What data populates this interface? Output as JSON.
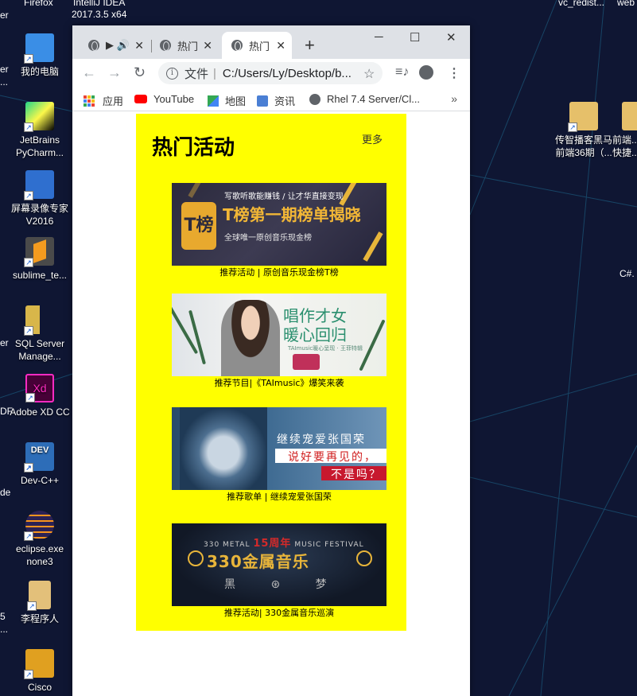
{
  "desktop": {
    "top_labels": [
      "Firefox",
      "IntelliJ IDEA",
      "2017.3.5 x64",
      "vc_redist...",
      "web"
    ],
    "icons_left": [
      {
        "label": "我的电脑",
        "icon": "computer-icon",
        "color": "#3a8ee6"
      },
      {
        "label": "JetBrains PyCharm...",
        "icon": "pycharm-icon",
        "color": "#21d789"
      },
      {
        "label": "屏幕录像专家 V2016",
        "icon": "screen-recorder-icon",
        "color": "#2f6fcf"
      },
      {
        "label": "sublime_te...",
        "icon": "sublime-icon",
        "color": "#f49b1f"
      },
      {
        "label": "SQL Server Manage...",
        "icon": "sql-server-icon",
        "color": "#d8b64a"
      },
      {
        "label": "Adobe XD CC",
        "icon": "adobe-xd-icon",
        "color": "#ff2bc2"
      },
      {
        "label": "Dev-C++",
        "icon": "devcpp-icon",
        "color": "#2d6db8"
      },
      {
        "label": "eclipse.exe none3",
        "icon": "eclipse-icon",
        "color": "#2c2255"
      },
      {
        "label": "李程序人",
        "icon": "document-icon",
        "color": "#e3c07a"
      },
      {
        "label": "Cisco",
        "icon": "cisco-icon",
        "color": "#e0a020"
      }
    ],
    "icons_right": [
      {
        "label": "传智播客黑马 前端36期（...",
        "icon": "folder-icon",
        "color": "#e6c06a"
      },
      {
        "label": "前端... 快捷...",
        "icon": "folder-icon",
        "color": "#e6c06a"
      }
    ],
    "edge_labels": [
      "er",
      "...",
      "er",
      "DF",
      "de",
      "5",
      "...",
      "C#.",
      "P"
    ]
  },
  "browser": {
    "tabs": [
      {
        "label": "▶ 🔊",
        "active": false
      },
      {
        "label": "热门",
        "active": false
      },
      {
        "label": "热门",
        "active": true
      }
    ],
    "new_tab": "+",
    "window_controls": {
      "minimize": "─",
      "maximize": "☐",
      "close": "✕"
    },
    "address": {
      "label": "文件",
      "url": "C:/Users/Ly/Desktop/b..."
    },
    "bookmarks": [
      {
        "label": "应用",
        "icon": "apps-icon"
      },
      {
        "label": "YouTube",
        "icon": "youtube-icon"
      },
      {
        "label": "地图",
        "icon": "maps-icon"
      },
      {
        "label": "资讯",
        "icon": "news-icon"
      },
      {
        "label": "Rhel 7.4 Server/Cl...",
        "icon": "globe-icon"
      }
    ],
    "bookmarks_more": "»"
  },
  "page": {
    "title": "热门活动",
    "more": "更多",
    "items": [
      {
        "caption": "推荐活动 | 原创音乐现金榜T榜",
        "banner": {
          "line1": "写歌听歌能赚钱 / 让才华直接变现",
          "headline": "T榜第一期榜单揭晓",
          "line3": "全球唯一原创音乐现金榜",
          "logo": "T榜"
        }
      },
      {
        "caption": "推荐节目|《TAImusic》爆笑来袭",
        "banner": {
          "line1": "唱作才女",
          "line2": "暖心回归",
          "line3": "TAImusic暖心呈现 · 王菲特辑"
        }
      },
      {
        "caption": "推荐歌单 | 继续宠爱张国荣",
        "banner": {
          "line1": "继续宠爱张国荣",
          "line2": "说好要再见的，",
          "line3": "不是吗？"
        }
      },
      {
        "caption": "推荐活动| 330金属音乐巡演",
        "banner": {
          "line1a": "330 METAL",
          "line1b": "15周年",
          "line1c": "MUSIC FESTIVAL",
          "headline": "330金属音乐",
          "logos": "黑 ⊛ 梦"
        }
      }
    ]
  },
  "colors": {
    "panel_bg": "#ffff00",
    "desktop_bg": "#0f1633",
    "accent_gold": "#e8b53a"
  }
}
